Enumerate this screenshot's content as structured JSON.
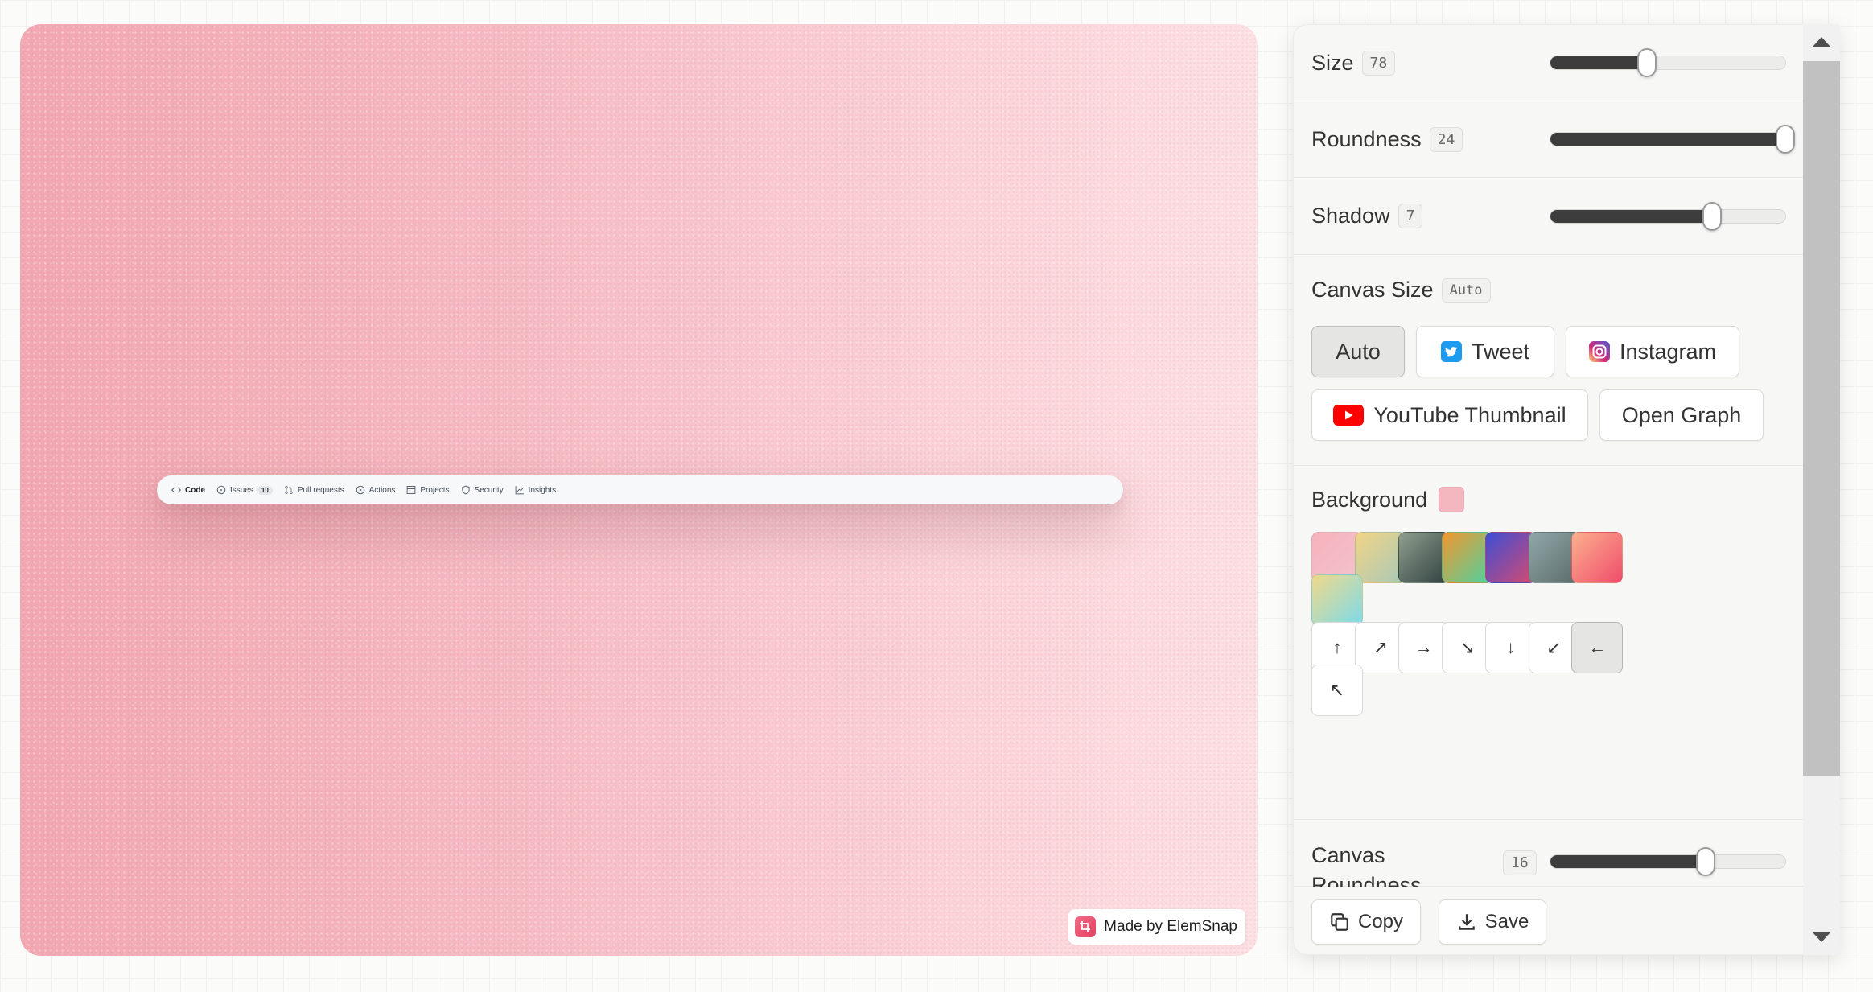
{
  "canvas": {
    "gradient": [
      "#f2a7b1",
      "#fde0e4"
    ],
    "nav": {
      "items": [
        {
          "label": "Code",
          "icon": "code-icon",
          "active": true
        },
        {
          "label": "Issues",
          "icon": "issue-icon",
          "count": "10"
        },
        {
          "label": "Pull requests",
          "icon": "pull-request-icon"
        },
        {
          "label": "Actions",
          "icon": "play-icon"
        },
        {
          "label": "Projects",
          "icon": "table-icon"
        },
        {
          "label": "Security",
          "icon": "shield-icon"
        },
        {
          "label": "Insights",
          "icon": "graph-icon"
        }
      ]
    },
    "watermark": "Made by ElemSnap"
  },
  "panel": {
    "size": {
      "label": "Size",
      "value": "78",
      "level": 0.41
    },
    "roundness": {
      "label": "Roundness",
      "value": "24",
      "level": 1.0
    },
    "shadow": {
      "label": "Shadow",
      "value": "7",
      "level": 0.69
    },
    "canvas_size": {
      "label": "Canvas Size",
      "value": "Auto",
      "options": [
        {
          "label": "Auto",
          "selected": true
        },
        {
          "label": "Tweet",
          "icon": "twitter-icon"
        },
        {
          "label": "Instagram",
          "icon": "instagram-icon"
        },
        {
          "label": "YouTube Thumbnail",
          "icon": "youtube-icon"
        },
        {
          "label": "Open Graph"
        }
      ]
    },
    "background": {
      "label": "Background",
      "current": "#f4b6bf",
      "swatches": [
        [
          "#f6b2bd",
          "#f3c3ca"
        ],
        [
          "#f2d487",
          "#a7c9b7"
        ],
        [
          "#8f9e8c",
          "#2f4040"
        ],
        [
          "#f2962e",
          "#4ad3a2"
        ],
        [
          "#3b4fd6",
          "#d94a6e"
        ],
        [
          "#90a8a8",
          "#5c6b6b"
        ],
        [
          "#fcb08e",
          "#ef4d6a"
        ],
        [
          "#f0d98a",
          "#7ddaea"
        ]
      ],
      "directions": [
        "↑",
        "↗",
        "→",
        "↘",
        "↓",
        "↙",
        "←",
        "↖"
      ],
      "selected_direction": 6
    },
    "canvas_roundness": {
      "label": "Canvas Roundness",
      "value": "16",
      "level": 0.66
    },
    "footer": {
      "copy_label": "Copy",
      "save_label": "Save"
    }
  }
}
